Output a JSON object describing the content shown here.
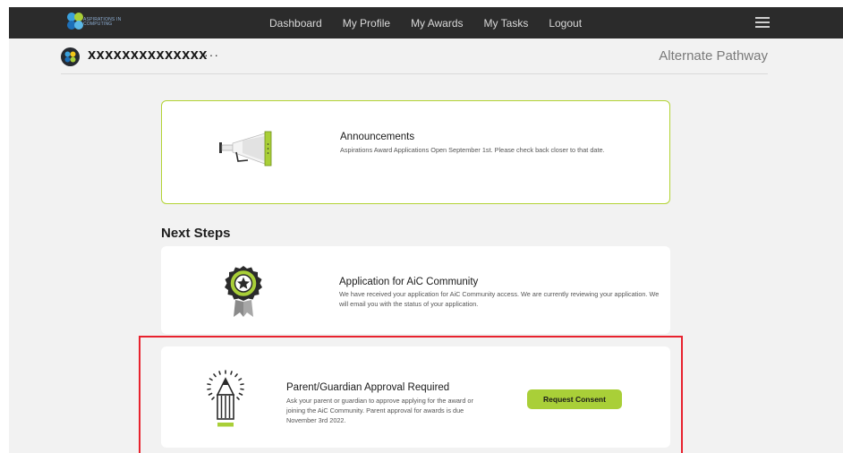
{
  "nav": {
    "logo_text": "ASPIRATIONS IN COMPUTING",
    "links": [
      "Dashboard",
      "My Profile",
      "My Awards",
      "My Tasks",
      "Logout"
    ]
  },
  "subheader": {
    "username": "XXXXXXXXXXXXXX",
    "more": "···",
    "pathway": "Alternate Pathway"
  },
  "announcement": {
    "title": "Announcements",
    "body": "Aspirations Award Applications Open September 1st. Please check back closer to that date."
  },
  "next_steps": {
    "heading": "Next Steps",
    "items": [
      {
        "title": "Application for AiC Community",
        "body": "We have received your application for AiC Community access. We are currently reviewing your application. We will email you with the status of your application."
      },
      {
        "title": "Parent/Guardian Approval Required",
        "body": "Ask your parent or guardian to approve applying for the award or joining the AiC Community. Parent approval for awards is due November 3rd 2022.",
        "button": "Request Consent"
      }
    ]
  },
  "colors": {
    "accent_green": "#a9cf38",
    "nav_bg": "#2b2b2b",
    "highlight_red": "#e8222e"
  }
}
